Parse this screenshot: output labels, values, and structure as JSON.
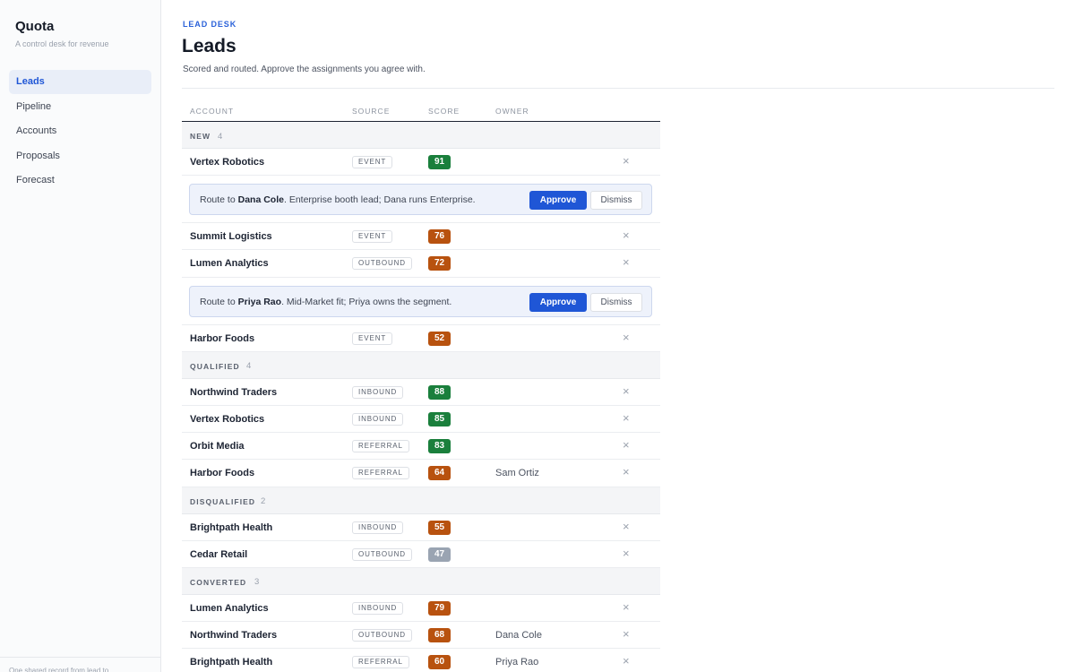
{
  "app": {
    "name": "Quota",
    "tagline": "A control desk for revenue"
  },
  "nav": [
    {
      "label": "Leads",
      "active": true
    },
    {
      "label": "Pipeline"
    },
    {
      "label": "Accounts"
    },
    {
      "label": "Proposals"
    },
    {
      "label": "Forecast"
    }
  ],
  "footer_text": "One shared record from lead to",
  "header": {
    "eyebrow": "LEAD DESK",
    "title": "Leads",
    "subtitle": "Scored and routed. Approve the assignments you agree with."
  },
  "columns": [
    "ACCOUNT",
    "SOURCE",
    "SCORE",
    "OWNER"
  ],
  "colors": {
    "accent": "#1f56d6",
    "score_high": "#1a7f3c",
    "score_mid": "#b8520f",
    "score_low": "#9aa4b2"
  },
  "icons": {
    "remove": "close-icon"
  },
  "actions": {
    "approve": "Approve",
    "dismiss": "Dismiss",
    "remove_glyph": "×"
  },
  "groups": [
    {
      "name": "NEW",
      "count": "4",
      "rows": [
        {
          "account": "Vertex Robotics",
          "source": "EVENT",
          "score": "91",
          "tier": "high",
          "owner": "",
          "suggestion": {
            "prefix": "Route to ",
            "name": "Dana Cole",
            "reason": ". Enterprise booth lead; Dana runs Enterprise."
          }
        },
        {
          "account": "Summit Logistics",
          "source": "EVENT",
          "score": "76",
          "tier": "mid",
          "owner": ""
        },
        {
          "account": "Lumen Analytics",
          "source": "OUTBOUND",
          "score": "72",
          "tier": "mid",
          "owner": "",
          "suggestion": {
            "prefix": "Route to ",
            "name": "Priya Rao",
            "reason": ". Mid-Market fit; Priya owns the segment."
          }
        },
        {
          "account": "Harbor Foods",
          "source": "EVENT",
          "score": "52",
          "tier": "mid",
          "owner": ""
        }
      ]
    },
    {
      "name": "QUALIFIED",
      "count": "4",
      "rows": [
        {
          "account": "Northwind Traders",
          "source": "INBOUND",
          "score": "88",
          "tier": "high",
          "owner": ""
        },
        {
          "account": "Vertex Robotics",
          "source": "INBOUND",
          "score": "85",
          "tier": "high",
          "owner": ""
        },
        {
          "account": "Orbit Media",
          "source": "REFERRAL",
          "score": "83",
          "tier": "high",
          "owner": ""
        },
        {
          "account": "Harbor Foods",
          "source": "REFERRAL",
          "score": "64",
          "tier": "mid",
          "owner": "Sam Ortiz"
        }
      ]
    },
    {
      "name": "DISQUALIFIED",
      "count": "2",
      "rows": [
        {
          "account": "Brightpath Health",
          "source": "INBOUND",
          "score": "55",
          "tier": "mid",
          "owner": ""
        },
        {
          "account": "Cedar Retail",
          "source": "OUTBOUND",
          "score": "47",
          "tier": "low",
          "owner": ""
        }
      ]
    },
    {
      "name": "CONVERTED",
      "count": "3",
      "rows": [
        {
          "account": "Lumen Analytics",
          "source": "INBOUND",
          "score": "79",
          "tier": "mid",
          "owner": ""
        },
        {
          "account": "Northwind Traders",
          "source": "OUTBOUND",
          "score": "68",
          "tier": "mid",
          "owner": "Dana Cole"
        },
        {
          "account": "Brightpath Health",
          "source": "REFERRAL",
          "score": "60",
          "tier": "mid",
          "owner": "Priya Rao"
        }
      ]
    }
  ]
}
